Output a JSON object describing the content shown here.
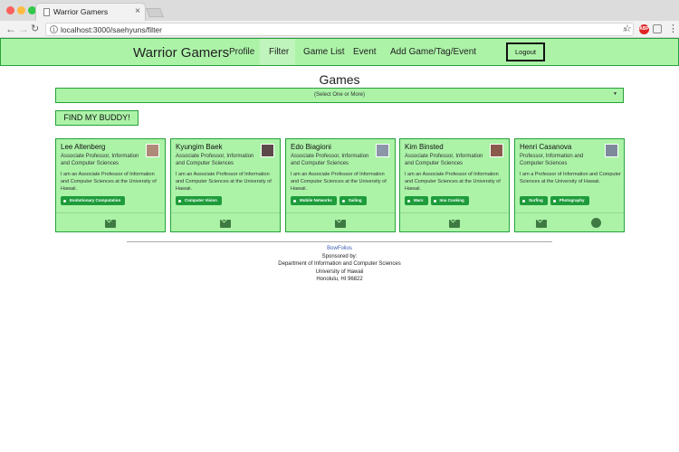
{
  "browser": {
    "tab_title": "Warrior Gamers",
    "url": "localhost:3000/saehyuns/filter"
  },
  "navbar": {
    "brand": "Warrior Gamers",
    "items": [
      "Profile",
      "Filter",
      "Game List",
      "Event",
      "Add Game/Tag/Event"
    ],
    "active": "Filter",
    "logout": "Logout"
  },
  "main": {
    "title": "Games",
    "select_placeholder": "(Select One or More)",
    "find_button": "FIND MY BUDDY!"
  },
  "cards": [
    {
      "name": "Lee Altenberg",
      "title": "Associate Professor, Information and Computer Sciences",
      "description": "I am an Associate Professor of Information and Computer Sciences at the University of Hawaii.",
      "tags": [
        "Evolutionary Computation"
      ],
      "avatar_color": "#b08a78",
      "github": false
    },
    {
      "name": "Kyungim Baek",
      "title": "Associate Professor, Information and Computer Sciences",
      "description": "I am an Associate Professor of Information and Computer Sciences at the University of Hawaii.",
      "tags": [
        "Computer Vision"
      ],
      "avatar_color": "#5c4a4a",
      "github": false
    },
    {
      "name": "Edo Biagioni",
      "title": "Associate Professor, Information and Computer Sciences",
      "description": "I am an Associate Professor of Information and Computer Sciences at the University of Hawaii.",
      "tags": [
        "Mobile Networks",
        "Sailing"
      ],
      "avatar_color": "#8b96a8",
      "github": false
    },
    {
      "name": "Kim Binsted",
      "title": "Associate Professor, Information and Computer Sciences",
      "description": "I am an Associate Professor of Information and Computer Sciences at the University of Hawaii.",
      "tags": [
        "Mars",
        "Imu Cooking"
      ],
      "avatar_color": "#8a5a4c",
      "github": false
    },
    {
      "name": "Henri Casanova",
      "title": "Professor, Information and Computer Sciences",
      "description": "I am a Professor of Information and Computer Sciences at the University of Hawaii.",
      "tags": [
        "Surfing",
        "Photography"
      ],
      "avatar_color": "#7d8a9c",
      "github": true
    }
  ],
  "footer": {
    "link": "BowFolios",
    "lines": [
      "Sponsored by:",
      "Department of Information and Computer Sciences",
      "University of Hawaii",
      "Honolulu, HI 96822"
    ]
  }
}
